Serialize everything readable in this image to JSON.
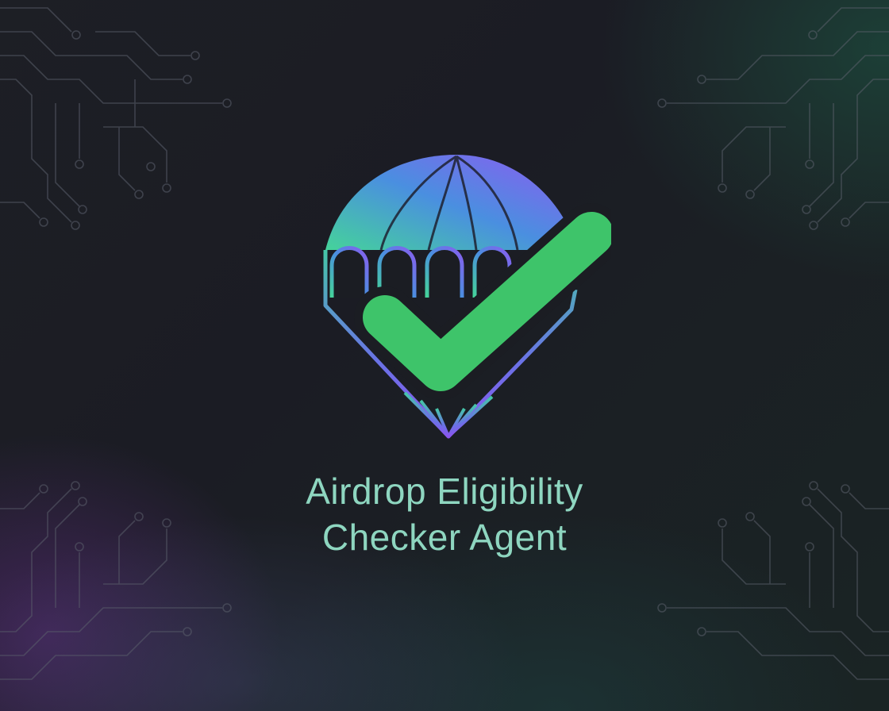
{
  "title": {
    "line1": "Airdrop Eligibility",
    "line2": "Checker Agent"
  },
  "logo": {
    "icon": "parachute-checkmark-icon"
  },
  "colors": {
    "background": "#1b1d23",
    "title_text": "#8ed6c0",
    "check_green": "#3ec46a",
    "gradient_teal": "#45d39a",
    "gradient_blue": "#4a8fe0",
    "gradient_purple": "#8b5cf0",
    "circuit_lines": "#5b606c"
  }
}
